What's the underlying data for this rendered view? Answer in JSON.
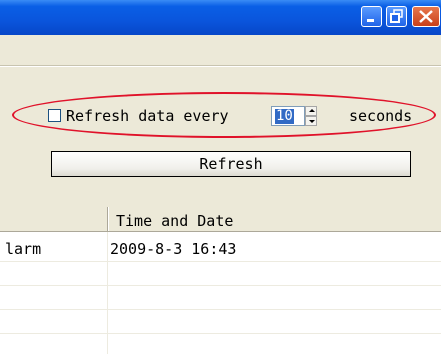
{
  "refresh": {
    "checkbox_label": "Refresh data every",
    "interval_value": "10",
    "unit_label": "seconds",
    "button_label": "Refresh"
  },
  "table": {
    "columns": [
      "",
      "Time and Date"
    ],
    "rows": [
      {
        "name": "larm",
        "time": "2009-8-3  16:43"
      }
    ]
  },
  "colors": {
    "titlebar": "#0A55DC",
    "highlight_ellipse": "#E0122A",
    "selection": "#316AC5"
  }
}
